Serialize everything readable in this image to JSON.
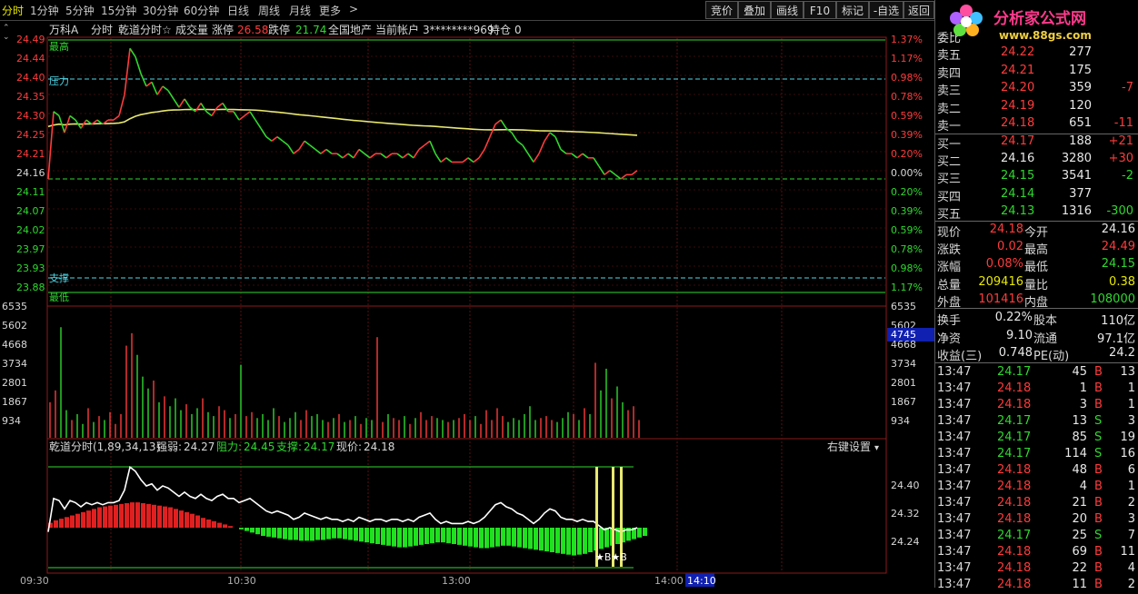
{
  "toolbar": {
    "periods": [
      "分时",
      "1分钟",
      "5分钟",
      "15分钟",
      "30分钟",
      "60分钟",
      "日线",
      "周线",
      "月线",
      "更多"
    ],
    "more_arrow": ">",
    "buttons": [
      "竞价",
      "叠加",
      "画线",
      "F10",
      "标记",
      "-自选",
      "返回"
    ]
  },
  "info_bar": {
    "stock": "万科A",
    "mode": "分时",
    "indicator": "乾道分时☆",
    "volume_label": "成交量",
    "limit_up_label": "涨停",
    "limit_up": "26.58",
    "limit_down_label": "跌停",
    "limit_down": "21.74",
    "sector": "全国地产",
    "account_label": "当前帐户",
    "account": "3********969",
    "position_label": "持仓",
    "position": "0"
  },
  "price_panel": {
    "left_ticks": [
      "24.49",
      "24.44",
      "24.40",
      "24.35",
      "24.30",
      "24.25",
      "24.21",
      "24.16",
      "24.11",
      "24.07",
      "24.02",
      "23.97",
      "23.93",
      "23.88"
    ],
    "right_ticks": [
      "1.37%",
      "1.17%",
      "0.98%",
      "0.78%",
      "0.59%",
      "0.39%",
      "0.20%",
      "0.00%",
      "0.20%",
      "0.39%",
      "0.59%",
      "0.78%",
      "0.98%",
      "1.17%"
    ],
    "labels": {
      "high": "最高",
      "resistance": "压力",
      "support": "支撑",
      "low": "最低"
    },
    "prev_close": 24.16,
    "price_min": 23.88,
    "price_max": 24.49
  },
  "volume_panel": {
    "ticks": [
      "6535",
      "5602",
      "4668",
      "3734",
      "2801",
      "1867",
      "934"
    ],
    "right_highlight": "4745",
    "max": 6535
  },
  "qiandao_panel": {
    "title": "乾道分时(1,89,34,13)",
    "strength_label": "强弱:",
    "strength": "24.27",
    "resistance_label": "阻力:",
    "resistance": "24.45",
    "support_label": "支撑:",
    "support": "24.17",
    "price_label": "现价:",
    "price": "24.18",
    "settings": "右键设置",
    "ticks": [
      "24.40",
      "24.32",
      "24.24"
    ],
    "marker": "★B★B"
  },
  "time_axis": {
    "labels": [
      "09:30",
      "10:30",
      "13:00",
      "14:00"
    ],
    "current": "14:10"
  },
  "logo": {
    "name": "分析家公式网",
    "url": "www.88gs.com"
  },
  "orderbook": {
    "header": "委比",
    "asks": [
      {
        "label": "卖五",
        "price": "24.22",
        "vol": "277",
        "chg": ""
      },
      {
        "label": "卖四",
        "price": "24.21",
        "vol": "175",
        "chg": ""
      },
      {
        "label": "卖三",
        "price": "24.20",
        "vol": "359",
        "chg": "-7"
      },
      {
        "label": "卖二",
        "price": "24.19",
        "vol": "120",
        "chg": ""
      },
      {
        "label": "卖一",
        "price": "24.18",
        "vol": "651",
        "chg": "-11"
      }
    ],
    "bids": [
      {
        "label": "买一",
        "price": "24.17",
        "vol": "188",
        "chg": "+21"
      },
      {
        "label": "买二",
        "price": "24.16",
        "vol": "3280",
        "chg": "+30"
      },
      {
        "label": "买三",
        "price": "24.15",
        "vol": "3541",
        "chg": "-2"
      },
      {
        "label": "买四",
        "price": "24.14",
        "vol": "377",
        "chg": ""
      },
      {
        "label": "买五",
        "price": "24.13",
        "vol": "1316",
        "chg": "-300"
      }
    ]
  },
  "quote": [
    {
      "l1": "现价",
      "v1": "24.18",
      "c1": "red",
      "l2": "今开",
      "v2": "24.16",
      "c2": "white"
    },
    {
      "l1": "涨跌",
      "v1": "0.02",
      "c1": "red",
      "l2": "最高",
      "v2": "24.49",
      "c2": "red"
    },
    {
      "l1": "涨幅",
      "v1": "0.08%",
      "c1": "red",
      "l2": "最低",
      "v2": "24.15",
      "c2": "green"
    },
    {
      "l1": "总量",
      "v1": "209416",
      "c1": "yellow",
      "l2": "量比",
      "v2": "0.38",
      "c2": "yellow"
    },
    {
      "l1": "外盘",
      "v1": "101416",
      "c1": "red",
      "l2": "内盘",
      "v2": "108000",
      "c2": "green"
    }
  ],
  "fundamentals": [
    {
      "l1": "换手",
      "v1": "0.22%",
      "l2": "股本",
      "v2": "110亿"
    },
    {
      "l1": "净资",
      "v1": "9.10",
      "l2": "流通",
      "v2": "97.1亿"
    },
    {
      "l1": "收益(三)",
      "v1": "0.748",
      "l2": "PE(动)",
      "v2": "24.2"
    }
  ],
  "ticks": [
    {
      "time": "13:47",
      "price": "24.17",
      "vol": "45",
      "side": "B",
      "n": "13"
    },
    {
      "time": "13:47",
      "price": "24.18",
      "vol": "1",
      "side": "B",
      "n": "1"
    },
    {
      "time": "13:47",
      "price": "24.18",
      "vol": "3",
      "side": "B",
      "n": "1"
    },
    {
      "time": "13:47",
      "price": "24.17",
      "vol": "13",
      "side": "S",
      "n": "3"
    },
    {
      "time": "13:47",
      "price": "24.17",
      "vol": "85",
      "side": "S",
      "n": "19"
    },
    {
      "time": "13:47",
      "price": "24.17",
      "vol": "114",
      "side": "S",
      "n": "16"
    },
    {
      "time": "13:47",
      "price": "24.18",
      "vol": "48",
      "side": "B",
      "n": "6"
    },
    {
      "time": "13:47",
      "price": "24.18",
      "vol": "4",
      "side": "B",
      "n": "1"
    },
    {
      "time": "13:47",
      "price": "24.18",
      "vol": "21",
      "side": "B",
      "n": "2"
    },
    {
      "time": "13:47",
      "price": "24.18",
      "vol": "20",
      "side": "B",
      "n": "3"
    },
    {
      "time": "13:47",
      "price": "24.17",
      "vol": "25",
      "side": "S",
      "n": "7"
    },
    {
      "time": "13:47",
      "price": "24.18",
      "vol": "69",
      "side": "B",
      "n": "11"
    },
    {
      "time": "13:47",
      "price": "24.18",
      "vol": "22",
      "side": "B",
      "n": "4"
    },
    {
      "time": "13:47",
      "price": "24.18",
      "vol": "11",
      "side": "B",
      "n": "2"
    }
  ],
  "colors": {
    "up": "#ff3b3b",
    "down": "#2fd82f",
    "avg": "#e8e870",
    "grid": "#7a1a1a",
    "text": "#c0c0c0"
  },
  "series": {
    "price": [
      24.16,
      24.32,
      24.31,
      24.27,
      24.31,
      24.3,
      24.28,
      24.3,
      24.29,
      24.3,
      24.29,
      24.3,
      24.3,
      24.31,
      24.36,
      24.47,
      24.45,
      24.41,
      24.38,
      24.39,
      24.36,
      24.38,
      24.37,
      24.35,
      24.33,
      24.35,
      24.33,
      24.32,
      24.34,
      24.32,
      24.31,
      24.33,
      24.34,
      24.32,
      24.32,
      24.3,
      24.31,
      24.32,
      24.3,
      24.28,
      24.26,
      24.25,
      24.26,
      24.25,
      24.24,
      24.22,
      24.23,
      24.25,
      24.24,
      24.23,
      24.22,
      24.23,
      24.22,
      24.22,
      24.21,
      24.22,
      24.21,
      24.23,
      24.22,
      24.21,
      24.22,
      24.22,
      24.21,
      24.22,
      24.22,
      24.21,
      24.22,
      24.21,
      24.23,
      24.24,
      24.25,
      24.22,
      24.2,
      24.21,
      24.2,
      24.2,
      24.2,
      24.21,
      24.2,
      24.21,
      24.23,
      24.26,
      24.29,
      24.3,
      24.28,
      24.27,
      24.25,
      24.24,
      24.22,
      24.2,
      24.22,
      24.25,
      24.27,
      24.26,
      24.23,
      24.22,
      24.22,
      24.21,
      24.22,
      24.21,
      24.21,
      24.19,
      24.17,
      24.18,
      24.17,
      24.16,
      24.17,
      24.17,
      24.18
    ],
    "avg_start": 24.3,
    "volume": [
      1800,
      2400,
      5602,
      1400,
      900,
      1200,
      700,
      1500,
      800,
      1100,
      900,
      1300,
      700,
      1200,
      4668,
      5300,
      4200,
      3100,
      2500,
      2900,
      1800,
      2100,
      1600,
      2000,
      1400,
      1700,
      1200,
      1500,
      2000,
      1300,
      1100,
      1600,
      1400,
      1000,
      1200,
      3700,
      1100,
      1300,
      1000,
      1200,
      900,
      1500,
      1100,
      800,
      1000,
      1300,
      900,
      1400,
      1100,
      1200,
      900,
      800,
      1000,
      1200,
      800,
      900,
      1100,
      700,
      1000,
      900,
      5100,
      800,
      1200,
      1000,
      900,
      1100,
      700,
      1000,
      1300,
      900,
      1100,
      1000,
      900,
      800,
      900,
      1000,
      1200,
      900,
      1100,
      700,
      1400,
      900,
      1500,
      1100,
      800,
      1000,
      900,
      1200,
      1600,
      900,
      1000,
      1100,
      900,
      800,
      1000,
      1300,
      1200,
      900,
      1500,
      1200,
      3800,
      2400,
      3500,
      2000,
      2600,
      1800,
      1400,
      1600,
      900
    ],
    "strength": [
      0.6,
      0.9,
      1.1,
      1.3,
      1.5,
      1.7,
      1.9,
      2.1,
      2.3,
      2.5,
      2.6,
      2.7,
      2.8,
      2.9,
      3.0,
      3.1,
      3.1,
      3.0,
      2.9,
      2.8,
      2.7,
      2.6,
      2.5,
      2.3,
      2.1,
      1.9,
      1.7,
      1.5,
      1.2,
      1.0,
      0.8,
      0.6,
      0.4,
      0.2,
      0,
      -0.2,
      -0.4,
      -0.6,
      -0.8,
      -1.0,
      -1.1,
      -1.2,
      -1.3,
      -1.4,
      -1.5,
      -1.5,
      -1.6,
      -1.6,
      -1.6,
      -1.5,
      -1.5,
      -1.4,
      -1.3,
      -1.3,
      -1.4,
      -1.5,
      -1.6,
      -1.7,
      -1.8,
      -1.9,
      -2.0,
      -2.1,
      -2.2,
      -2.3,
      -2.4,
      -2.4,
      -2.3,
      -2.2,
      -2.1,
      -2.0,
      -1.9,
      -1.8,
      -1.8,
      -1.9,
      -2.0,
      -2.1,
      -2.2,
      -2.3,
      -2.4,
      -2.5,
      -2.5,
      -2.4,
      -2.3,
      -2.2,
      -2.2,
      -2.3,
      -2.4,
      -2.5,
      -2.6,
      -2.7,
      -2.8,
      -2.9,
      -3.0,
      -3.1,
      -3.2,
      -3.3,
      -3.4,
      -3.3,
      -3.2,
      -3.0,
      -2.8,
      -2.6,
      -2.4,
      -2.2,
      -2.0,
      -1.8,
      -1.6,
      -1.4,
      -1.2,
      -1.0
    ]
  }
}
